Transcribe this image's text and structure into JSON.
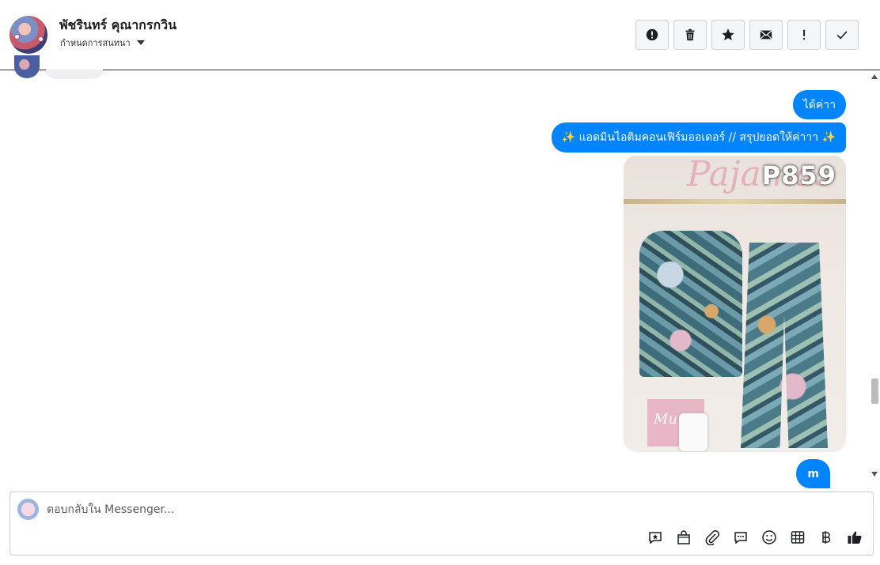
{
  "header": {
    "contact_name": "พัชรินทร์ คุณากรกวิน",
    "assign_label": "กำหนดการสนทนา"
  },
  "toolbar": {
    "buttons": [
      {
        "name": "report-icon",
        "label": "Report"
      },
      {
        "name": "trash-icon",
        "label": "Delete"
      },
      {
        "name": "star-icon",
        "label": "Star"
      },
      {
        "name": "envelope-icon",
        "label": "Mark unread"
      },
      {
        "name": "exclamation-icon",
        "label": "Follow up"
      },
      {
        "name": "check-icon",
        "label": "Done"
      }
    ]
  },
  "messages": {
    "m1": "ได้ค่าา",
    "m2": "✨ แอดมินไอติมคอนเฟิร์มออเดอร์ // สรุปยอดให้ค่าาา ✨",
    "m3": "m",
    "photo": {
      "sign_text": "Pajamas",
      "product_code": "P859",
      "box_text": "Mu"
    }
  },
  "composer": {
    "placeholder": "ตอบกลับใน Messenger...",
    "tools": [
      "saved-reply-icon",
      "shopping-bag-icon",
      "paperclip-icon",
      "chat-bubble-icon",
      "emoji-icon",
      "table-icon",
      "baht-icon",
      "thumbs-up-icon"
    ]
  },
  "colors": {
    "accent": "#0084ff",
    "bubble_text": "#ffffff",
    "border": "#ccd0d5"
  }
}
